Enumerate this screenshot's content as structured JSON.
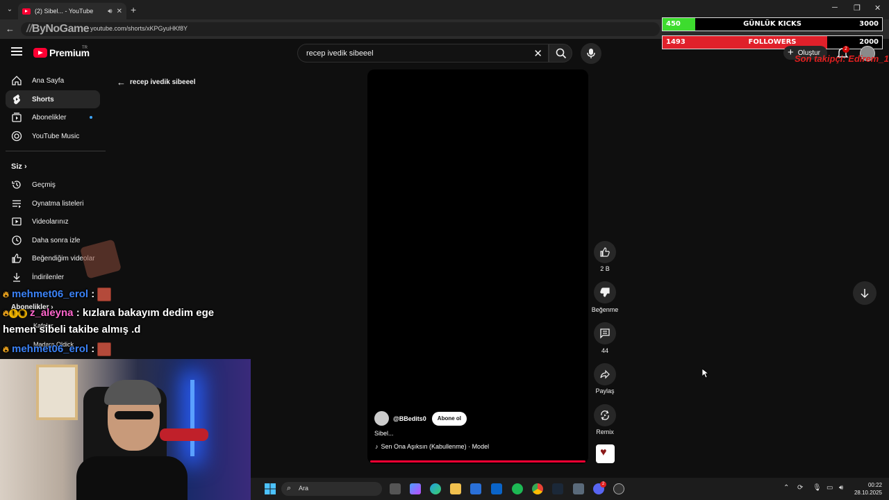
{
  "browser": {
    "tab_title": "(2) Sibel... - YouTube",
    "url": "youtube.com/shorts/xKPGyuHKf8Y",
    "brand_overlay": "ByNoGame"
  },
  "overlay": {
    "kicks": {
      "current": "450",
      "label": "GÜNLÜK KICKS",
      "goal": "3000",
      "progress": 0.15,
      "color": "#3ddc2e"
    },
    "followers": {
      "current": "1493",
      "label": "FOLLOWERS",
      "goal": "2000",
      "progress": 0.75,
      "color": "#e0202a"
    },
    "last_follower": "Son takipçi: Edirem_1"
  },
  "header": {
    "logo_text": "Premium",
    "logo_region": "TR",
    "search_value": "recep ivedik sibeeel",
    "create_label": "Oluştur",
    "notif_count": "2"
  },
  "sidebar": {
    "main_items": [
      {
        "label": "Ana Sayfa",
        "icon": "home-icon"
      },
      {
        "label": "Shorts",
        "icon": "shorts-icon"
      },
      {
        "label": "Abonelikler",
        "icon": "subscriptions-icon"
      },
      {
        "label": "YouTube Music",
        "icon": "music-icon"
      }
    ],
    "you_heading": "Siz",
    "you_items": [
      {
        "label": "Geçmiş",
        "icon": "history-icon"
      },
      {
        "label": "Oynatma listeleri",
        "icon": "playlist-icon"
      },
      {
        "label": "Videolarınız",
        "icon": "your-videos-icon"
      },
      {
        "label": "Daha sonra izle",
        "icon": "watch-later-icon"
      },
      {
        "label": "Beğendiğim videolar",
        "icon": "liked-icon"
      },
      {
        "label": "İndirilenler",
        "icon": "download-icon"
      }
    ],
    "subs_heading": "Abonelikler",
    "subs_items": [
      "Kafalar",
      "Madara Oldick"
    ]
  },
  "back_query": "recep ivedik sibeeel",
  "short": {
    "channel": "@BBedits0",
    "subscribe_label": "Abone ol",
    "title": "Sibel...",
    "music": "Sen Ona Aşıksın (Kabullenme) · Model",
    "progress": 1.0
  },
  "actions": {
    "like_count": "2 B",
    "dislike_label": "Beğenme",
    "comment_count": "44",
    "share_label": "Paylaş",
    "remix_label": "Remix"
  },
  "chat": [
    {
      "user": "mehmet06_erol",
      "sep": " :",
      "text": ""
    },
    {
      "user": "z_aleyna",
      "sep": " :",
      "text": " kızlara bakayım dedim ege",
      "text2": "hemen sibeli takibe almış .d"
    },
    {
      "user": "mehmet06_erol",
      "sep": " :",
      "text": ""
    }
  ],
  "taskbar": {
    "search_placeholder": "Ara",
    "time": "00:22",
    "date": "28.10.2025",
    "discord_badge": "2"
  }
}
